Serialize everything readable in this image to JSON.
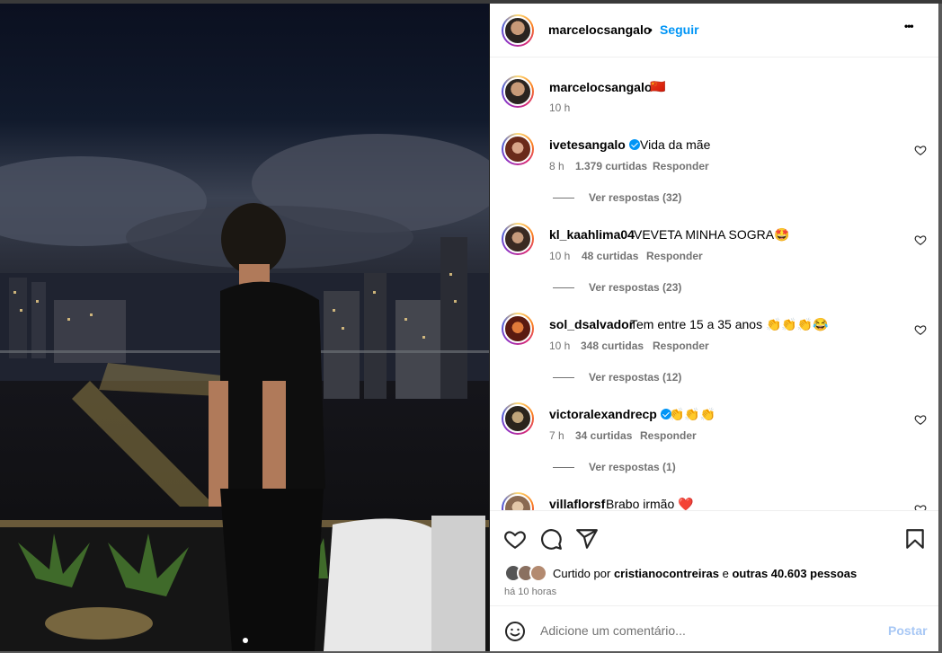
{
  "post": {
    "author": "marcelocsangalo",
    "follow_label": "Seguir",
    "more_label": "•••",
    "separator": "•",
    "caption_emoji": "🇨🇳",
    "caption_time": "10 h"
  },
  "comments": [
    {
      "user": "ivetesangalo",
      "verified": true,
      "text": "Vida da mãe",
      "time": "8 h",
      "likes": "1.379 curtidas",
      "reply_label": "Responder",
      "view_replies": "Ver respostas (32)"
    },
    {
      "user": "kl_kaahlima04",
      "verified": false,
      "text": "VEVETA MINHA SOGRA🤩",
      "time": "10 h",
      "likes": "48 curtidas",
      "reply_label": "Responder",
      "view_replies": "Ver respostas (23)"
    },
    {
      "user": "sol_dsalvador",
      "verified": false,
      "text": "Tem entre 15 a 35 anos 👏👏👏😂",
      "time": "10 h",
      "likes": "348 curtidas",
      "reply_label": "Responder",
      "view_replies": "Ver respostas (12)"
    },
    {
      "user": "victoralexandrecp",
      "verified": true,
      "text": "👏👏👏",
      "time": "7 h",
      "likes": "34 curtidas",
      "reply_label": "Responder",
      "view_replies": "Ver respostas (1)"
    },
    {
      "user": "villaflorsf",
      "verified": false,
      "text": "Brabo irmão ❤️"
    }
  ],
  "likes": {
    "prefix": "Curtido por",
    "user": "cristianocontreiras",
    "middle": "e",
    "others": "outras 40.603 pessoas",
    "time_ago": "há 10 horas"
  },
  "add_comment": {
    "placeholder": "Adicione um comentário...",
    "post_label": "Postar",
    "emoji_icon": "smiley-icon"
  },
  "colors": {
    "accent": "#0095f6",
    "muted": "#737373",
    "post_disabled": "#a8c8f5"
  }
}
